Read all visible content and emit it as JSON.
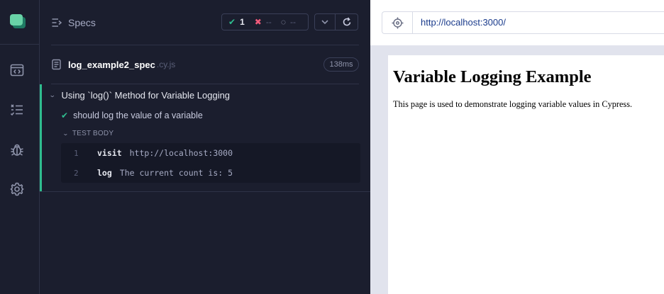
{
  "nav": {
    "items": [
      {
        "icon": "browser-code-icon"
      },
      {
        "icon": "test-list-icon"
      },
      {
        "icon": "bug-icon"
      },
      {
        "icon": "gear-icon"
      }
    ]
  },
  "specs_header": {
    "title": "Specs",
    "stats": {
      "passed_icon": "check-icon",
      "passed": "1",
      "failed_icon": "x-icon",
      "failed": "--",
      "pending_icon": "spinner-icon",
      "pending": "--"
    }
  },
  "spec_file": {
    "name": "log_example2_spec",
    "extension": ".cy.js",
    "duration": "138ms"
  },
  "suite": {
    "title": "Using `log()` Method for Variable Logging",
    "test": {
      "title": "should log the value of a variable",
      "status": "passed",
      "body_label": "TEST BODY",
      "commands": [
        {
          "number": "1",
          "name": "visit",
          "message": "http://localhost:3000"
        },
        {
          "number": "2",
          "name": "log",
          "message": "The current count is: 5"
        }
      ]
    }
  },
  "aut": {
    "url": "http://localhost:3000/",
    "page": {
      "heading": "Variable Logging Example",
      "paragraph": "This page is used to demonstrate logging variable values in Cypress."
    }
  },
  "colors": {
    "accent_pass": "#2fbd8f",
    "fail": "#f15a7a",
    "background": "#1b1e2e",
    "url_text": "#1a3b8c"
  }
}
